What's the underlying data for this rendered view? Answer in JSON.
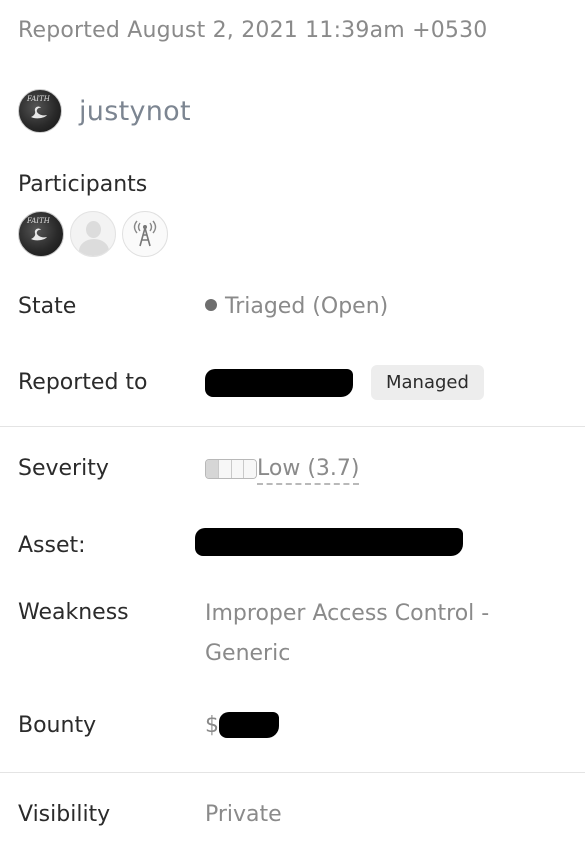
{
  "report": {
    "reported_text": "Reported August 2, 2021 11:39am +0530",
    "reporter": "justynot",
    "avatar_text": "FAITH"
  },
  "participants": {
    "label": "Participants",
    "avatars": [
      "reporter-avatar",
      "default-user-avatar",
      "radio-tower-avatar"
    ]
  },
  "fields": {
    "state": {
      "label": "State",
      "value": "Triaged (Open)",
      "dot_color": "#6e6e6e"
    },
    "reported_to": {
      "label": "Reported to",
      "badge": "Managed"
    },
    "severity": {
      "label": "Severity",
      "value": "Low (3.7)",
      "level_fraction": 0.25
    },
    "asset": {
      "label": "Asset:"
    },
    "weakness": {
      "label": "Weakness",
      "value": "Improper Access Control - Generic"
    },
    "bounty": {
      "label": "Bounty",
      "currency": "$"
    },
    "visibility": {
      "label": "Visibility",
      "value": "Private"
    }
  }
}
